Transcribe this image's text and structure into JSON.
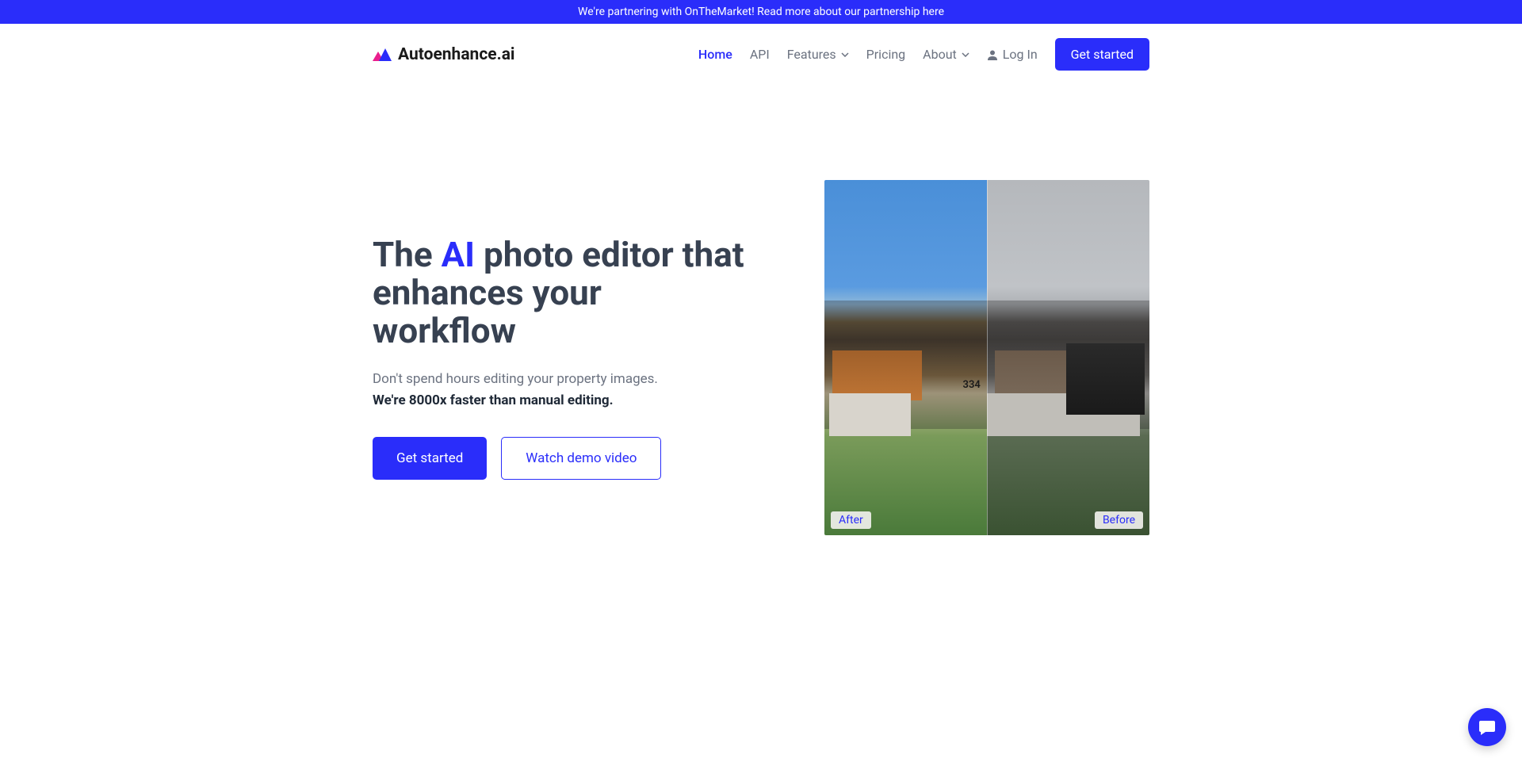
{
  "announcement": "We're partnering with OnTheMarket! Read more about our partnership here",
  "brand": "Autoenhance.ai",
  "nav": {
    "home": "Home",
    "api": "API",
    "features": "Features",
    "pricing": "Pricing",
    "about": "About",
    "login": "Log In",
    "cta": "Get started"
  },
  "hero": {
    "title_pre": "The ",
    "title_accent": "AI",
    "title_post": " photo editor that enhances your workflow",
    "subtitle": "Don't spend hours editing your property images.",
    "subtitle_bold": "We're 8000x faster than manual editing.",
    "cta_primary": "Get started",
    "cta_secondary": "Watch demo video"
  },
  "image": {
    "house_number": "334",
    "label_after": "After",
    "label_before": "Before"
  },
  "colors": {
    "primary": "#2A2DFA",
    "text_dark": "#374151",
    "text_muted": "#6b7280"
  }
}
